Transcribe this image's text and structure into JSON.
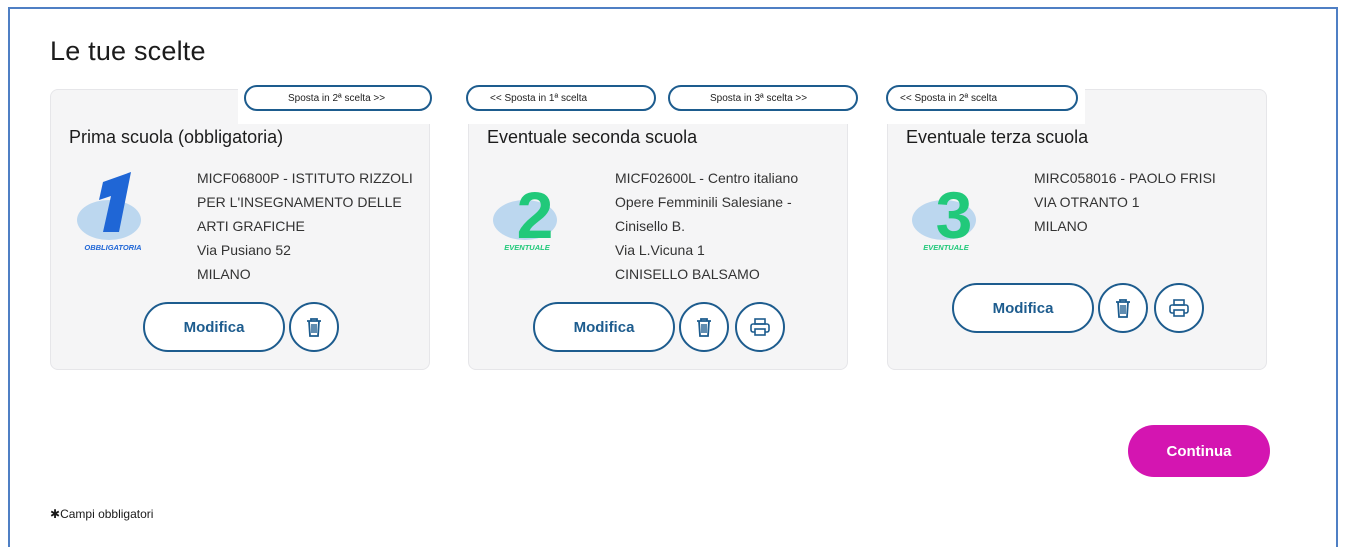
{
  "page": {
    "title": "Le tue scelte"
  },
  "move_buttons": [
    {
      "label": "Sposta in 2ª scelta  >>"
    },
    {
      "label": "<<  Sposta in 1ª scelta"
    },
    {
      "label": "Sposta in 3ª scelta  >>"
    },
    {
      "label": "<<  Sposta in 2ª scelta"
    }
  ],
  "cards": [
    {
      "title": "Prima scuola (obbligatoria)",
      "badge_number": "1",
      "badge_label": "OBBLIGATORIA",
      "badge_color": "#1f66d6",
      "lines": [
        "MICF06800P - ISTITUTO RIZZOLI",
        "PER L'INSEGNAMENTO DELLE",
        "ARTI GRAFICHE",
        "Via Pusiano 52",
        "MILANO"
      ],
      "modify_label": "Modifica"
    },
    {
      "title": "Eventuale seconda scuola",
      "badge_number": "2",
      "badge_label": "EVENTUALE",
      "badge_color": "#21c97a",
      "lines": [
        "MICF02600L - Centro italiano",
        "Opere Femminili Salesiane -",
        "Cinisello B.",
        "Via L.Vicuna 1",
        "CINISELLO BALSAMO"
      ],
      "modify_label": "Modifica"
    },
    {
      "title": "Eventuale terza scuola",
      "badge_number": "3",
      "badge_label": "EVENTUALE",
      "badge_color": "#21c97a",
      "lines": [
        "MIRC058016 - PAOLO FRISI",
        "VIA OTRANTO 1",
        "MILANO"
      ],
      "modify_label": "Modifica"
    }
  ],
  "actions": {
    "continue_label": "Continua"
  },
  "footer": {
    "required_note": "Campi obbligatori",
    "required_mark": "✱"
  },
  "icons": {
    "delete": "trash-icon",
    "print": "printer-icon"
  },
  "colors": {
    "primary": "#1d5c8e",
    "accent": "#d415b1"
  }
}
